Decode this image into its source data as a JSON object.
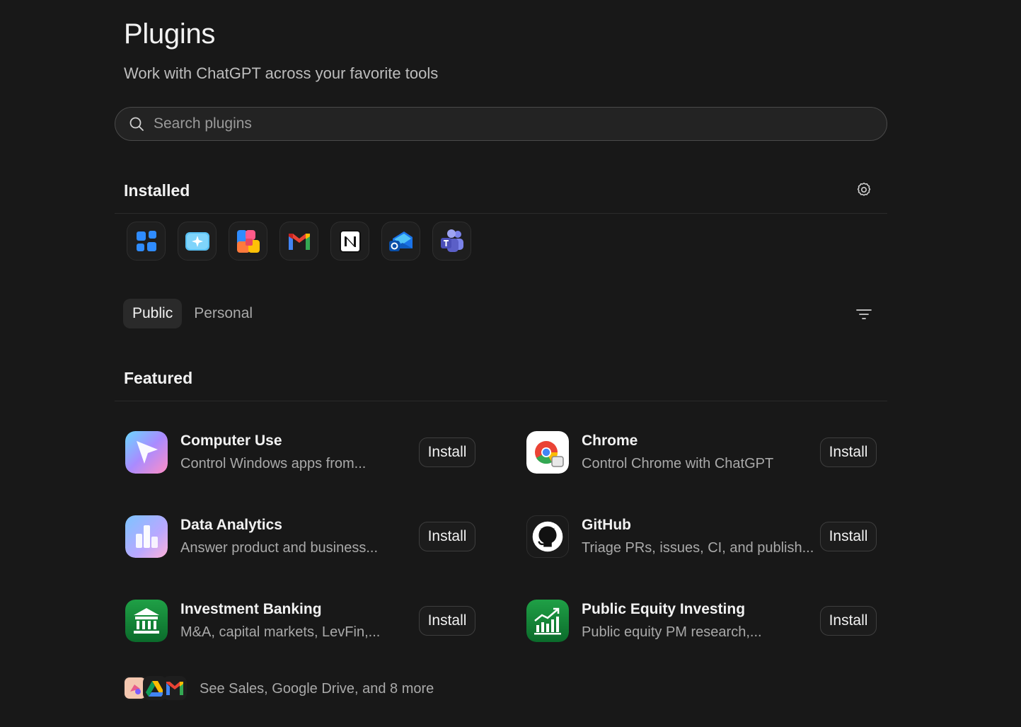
{
  "header": {
    "title": "Plugins",
    "subtitle": "Work with ChatGPT across your favorite tools"
  },
  "search": {
    "placeholder": "Search plugins",
    "value": ""
  },
  "installed": {
    "heading": "Installed",
    "icons": [
      "apps-grid-icon",
      "sparkle-window-icon",
      "office-shapes-icon",
      "gmail-icon",
      "notion-icon",
      "outlook-icon",
      "teams-icon"
    ]
  },
  "tabs": [
    {
      "label": "Public",
      "active": true
    },
    {
      "label": "Personal",
      "active": false
    }
  ],
  "featured": {
    "heading": "Featured",
    "items": [
      {
        "name": "Computer Use",
        "description": "Control Windows apps from...",
        "button": "Install",
        "icon": "cursor-arrow-icon"
      },
      {
        "name": "Chrome",
        "description": "Control Chrome with ChatGPT",
        "button": "Install",
        "icon": "chrome-icon"
      },
      {
        "name": "Data Analytics",
        "description": "Answer product and business...",
        "button": "Install",
        "icon": "bar-chart-icon"
      },
      {
        "name": "GitHub",
        "description": "Triage PRs, issues, CI, and publish...",
        "button": "Install",
        "icon": "github-icon"
      },
      {
        "name": "Investment Banking",
        "description": "M&A, capital markets, LevFin,...",
        "button": "Install",
        "icon": "bank-icon"
      },
      {
        "name": "Public Equity Investing",
        "description": "Public equity PM research,...",
        "button": "Install",
        "icon": "growth-chart-icon"
      }
    ]
  },
  "more": {
    "label": "See Sales, Google Drive, and 8 more"
  },
  "colors": {
    "background": "#181818",
    "text": "#ececec",
    "muted": "#a9a9a9",
    "border": "#3e3e3e"
  }
}
